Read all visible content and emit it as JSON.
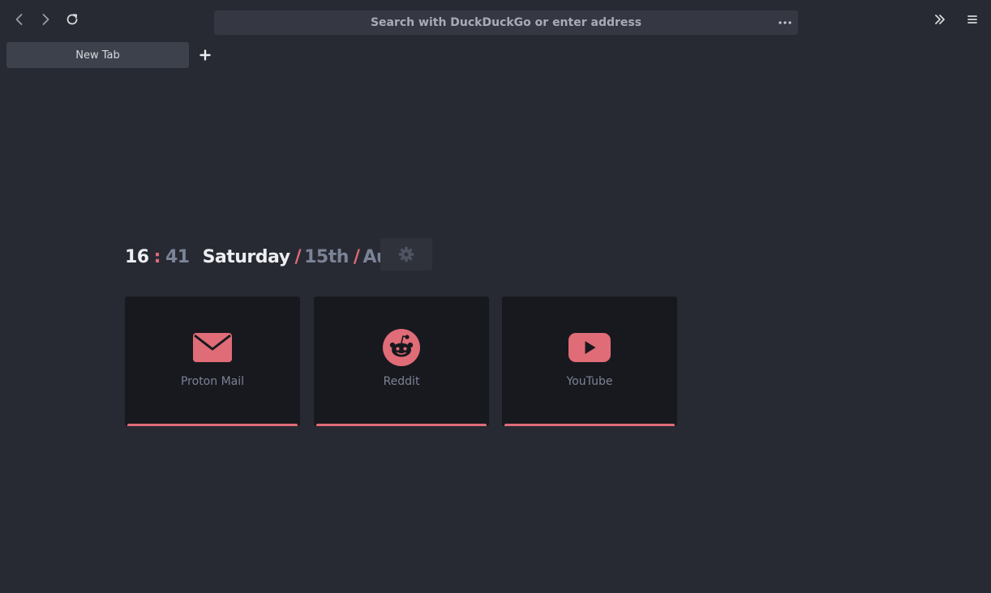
{
  "browser": {
    "address_placeholder": "Search with DuckDuckGo or enter address",
    "tabs": [
      {
        "label": "New Tab"
      }
    ]
  },
  "clock": {
    "hours": "16",
    "separator": ":",
    "minutes": "41",
    "weekday": "Saturday",
    "date_separator": "/",
    "day": "15th",
    "month": "August"
  },
  "bookmarks": [
    {
      "label": "Proton Mail",
      "icon": "envelope-icon"
    },
    {
      "label": "Reddit",
      "icon": "reddit-icon"
    },
    {
      "label": "YouTube",
      "icon": "youtube-icon"
    }
  ],
  "colors": {
    "background": "#282a33",
    "card": "#18191e",
    "accent": "#e06c78",
    "dim_text": "#7b8396"
  }
}
